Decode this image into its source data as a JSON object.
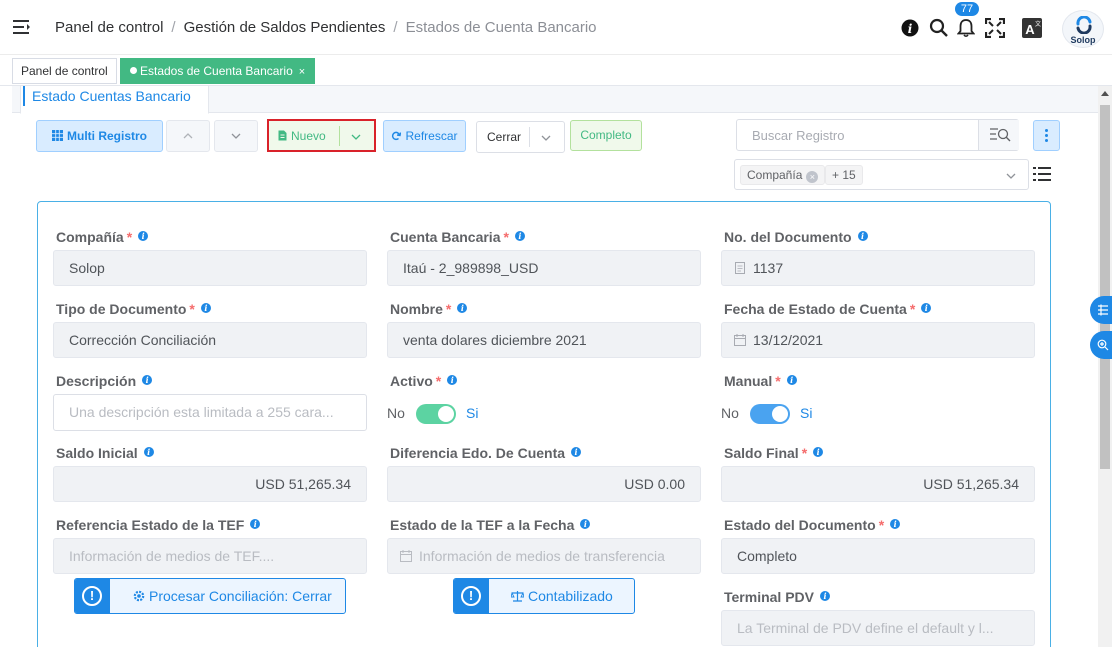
{
  "header": {
    "breadcrumb": [
      "Panel de control",
      "Gestión de Saldos Pendientes",
      "Estados de Cuenta Bancario"
    ],
    "notifications_count": "77",
    "user_label": "Solop"
  },
  "tabs": {
    "dashboard": "Panel de control",
    "active": "Estados de Cuenta Bancario",
    "close": "×"
  },
  "window": {
    "tab_title": "Estado Cuentas Bancario"
  },
  "toolbar": {
    "multi_record": "Multi Registro",
    "new": "Nuevo",
    "refresh": "Refrescar",
    "doc_action": "Cerrar",
    "doc_status": "Completo",
    "search_placeholder": "Buscar Registro",
    "column_chip": "Compañía",
    "more_chip": "+ 15"
  },
  "form": {
    "company": {
      "label": "Compañía",
      "value": "Solop"
    },
    "bank_account": {
      "label": "Cuenta Bancaria",
      "value": "Itaú - 2_989898_USD"
    },
    "document_no": {
      "label": "No. del Documento",
      "value": "1137"
    },
    "doc_type": {
      "label": "Tipo de Documento",
      "value": "Corrección Conciliación"
    },
    "name": {
      "label": "Nombre",
      "value": "venta dolares diciembre 2021"
    },
    "statement_date": {
      "label": "Fecha de Estado de Cuenta",
      "value": "13/12/2021"
    },
    "description": {
      "label": "Descripción",
      "placeholder": "Una descripción esta limitada a 255 cara..."
    },
    "active": {
      "label": "Activo",
      "off": "No",
      "on": "Si",
      "value": true
    },
    "manual": {
      "label": "Manual",
      "off": "No",
      "on": "Si",
      "value": true
    },
    "beginning_balance": {
      "label": "Saldo Inicial",
      "value": "USD 51,265.34"
    },
    "statement_difference": {
      "label": "Diferencia Edo. De Cuenta",
      "value": "USD 0.00"
    },
    "ending_balance": {
      "label": "Saldo Final",
      "value": "USD 51,265.34"
    },
    "eft_reference": {
      "label": "Referencia Estado de la TEF",
      "placeholder": "Información de medios de TEF...."
    },
    "eft_date": {
      "label": "Estado de la TEF a la Fecha",
      "placeholder": "Información de medios de transferencia"
    },
    "doc_status": {
      "label": "Estado del Documento",
      "value": "Completo"
    },
    "pos_terminal": {
      "label": "Terminal PDV",
      "placeholder": "La Terminal de PDV define el default y l..."
    },
    "process_button": "Procesar Conciliación: Cerrar",
    "posted_button": "Contabilizado"
  },
  "colors": {
    "primary": "#1e88e5",
    "success": "#42b983",
    "active_toggle": "#5cd3a2",
    "manual_toggle": "#4aa3f0",
    "highlight_border": "#d9222a"
  }
}
